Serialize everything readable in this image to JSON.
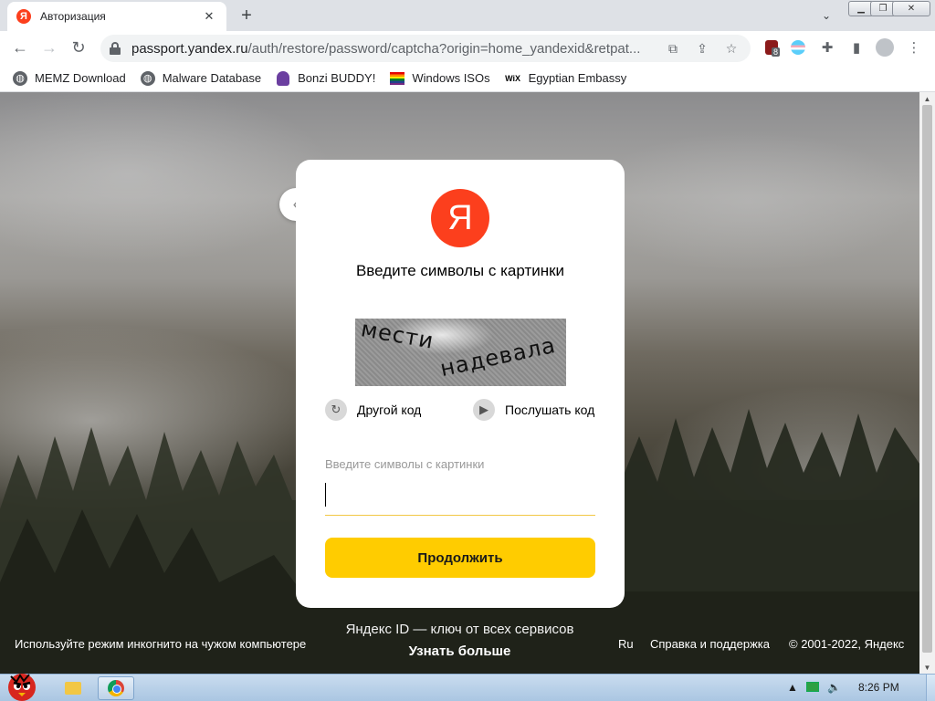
{
  "browser": {
    "tab_title": "Авторизация",
    "tab_favicon": "Я",
    "url_host": "passport.yandex.ru",
    "url_path": "/auth/restore/password/captcha?origin=home_yandexid&retpat...",
    "extension_badge": "8"
  },
  "bookmarks": [
    {
      "label": "MEMZ Download",
      "icon": "globe-icon"
    },
    {
      "label": "Malware Database",
      "icon": "globe-icon"
    },
    {
      "label": "Bonzi BUDDY!",
      "icon": "bonzi-icon"
    },
    {
      "label": "Windows ISOs",
      "icon": "rainbow-flag-icon"
    },
    {
      "label": "Egyptian Embassy",
      "icon": "wix-icon"
    }
  ],
  "auth": {
    "logo_letter": "Я",
    "title": "Введите символы с картинки",
    "captcha": {
      "word1": "мести",
      "word2": "надевала"
    },
    "other_code": "Другой код",
    "listen_code": "Послушать код",
    "field_label": "Введите символы с картинки",
    "field_value": "",
    "continue": "Продолжить"
  },
  "footer": {
    "incognito": "Используйте режим инкогнито на чужом компьютере",
    "slogan": "Яндекс ID — ключ от всех сервисов",
    "learn_more": "Узнать больше",
    "lang": "Ru",
    "help": "Справка и поддержка",
    "copyright": "© 2001-2022, Яндекс"
  },
  "taskbar": {
    "clock": "8:26 PM"
  },
  "colors": {
    "brand_red": "#fc3f1d",
    "button_yellow": "#ffcc00"
  }
}
